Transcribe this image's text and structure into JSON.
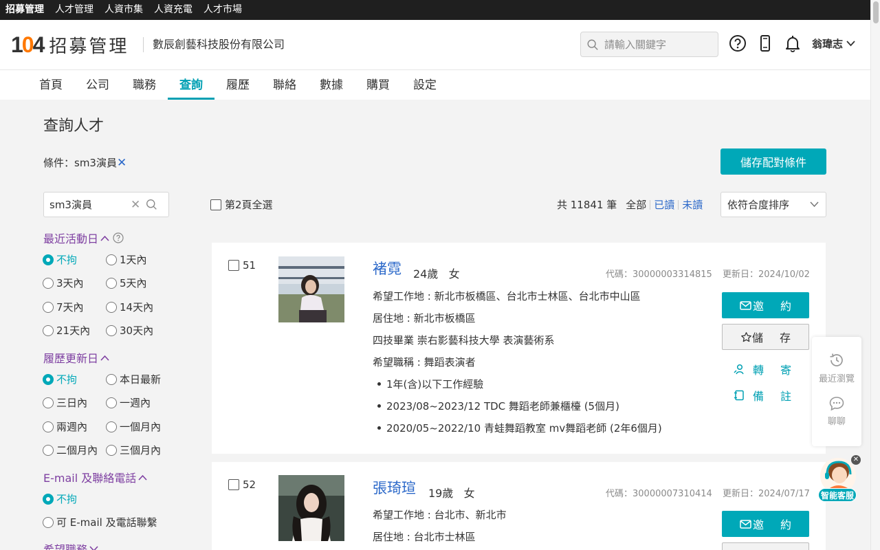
{
  "topbar": {
    "items": [
      "招募管理",
      "人才管理",
      "人資市集",
      "人資充電",
      "人才市場"
    ]
  },
  "header": {
    "logo_number": "104",
    "logo_title": "招募管理",
    "company": "數辰創藝科技股份有限公司",
    "search_placeholder": "請輸入關鍵字",
    "user_name": "翁瑋志"
  },
  "nav": {
    "items": [
      "首頁",
      "公司",
      "職務",
      "查詢",
      "履歷",
      "聯絡",
      "數據",
      "購買",
      "設定"
    ],
    "active": "查詢"
  },
  "page": {
    "title": "查詢人才",
    "conditions_label": "條件：sm3演員",
    "conditions_clear": "✕",
    "save_button": "儲存配對條件"
  },
  "sidebar": {
    "search_value": "sm3演員",
    "filters": [
      {
        "title": "最近活動日",
        "options": [
          "不拘",
          "1天內",
          "3天內",
          "5天內",
          "7天內",
          "14天內",
          "21天內",
          "30天內"
        ],
        "selected": "不拘"
      },
      {
        "title": "履歷更新日",
        "options": [
          "不拘",
          "本日最新",
          "三日內",
          "一週內",
          "兩週內",
          "一個月內",
          "二個月內",
          "三個月內"
        ],
        "selected": "不拘"
      },
      {
        "title": "E-mail 及聯絡電話",
        "options": [
          "不拘",
          "可 E-mail 及電話聯繫"
        ],
        "selected": "不拘"
      },
      {
        "title": "希望職務"
      }
    ]
  },
  "results": {
    "select_all_label": "第2頁全選",
    "total_text": "共 11841 筆",
    "filter_all": "全部",
    "filter_read": "已讀",
    "filter_unread": "未讀",
    "sort": "依符合度排序"
  },
  "candidates": [
    {
      "index": "51",
      "name": "褚霓",
      "age": "24歲",
      "gender": "女",
      "code": "代碼：30000003314815",
      "updated": "更新日：2024/10/02",
      "desired_location": "希望工作地 : 新北市板橋區、台北市士林區、台北市中山區",
      "residence": "居住地 : 新北市板橋區",
      "education": "四技畢業 崇右影藝科技大學 表演藝術系",
      "desired_title": "希望職稱 : 舞蹈表演者",
      "experience": [
        "1年(含)以下工作經驗",
        "2023/08~2023/12 TDC 舞蹈老師兼櫃檯 (5個月)",
        "2020/05~2022/10 青蛙舞蹈教室 mv舞蹈老師 (2年6個月)"
      ]
    },
    {
      "index": "52",
      "name": "張琦瑄",
      "age": "19歲",
      "gender": "女",
      "code": "代碼：30000007310414",
      "updated": "更新日：2024/07/17",
      "desired_location": "希望工作地 : 台北市、新北市",
      "residence": "居住地 : 台北市士林區"
    }
  ],
  "actions": {
    "invite": "邀約",
    "save": "儲存",
    "forward": "轉寄",
    "note": "備註"
  },
  "floating": {
    "recent": "最近瀏覽",
    "chat": "聊聊",
    "assistant": "智能客服",
    "close": "✕"
  },
  "colors": {
    "accent": "#00a8b8",
    "link": "#2b68c9",
    "filter_title": "#7e3fa1",
    "topbar": "#1f1f1f",
    "brand_orange": "#ff7800"
  }
}
